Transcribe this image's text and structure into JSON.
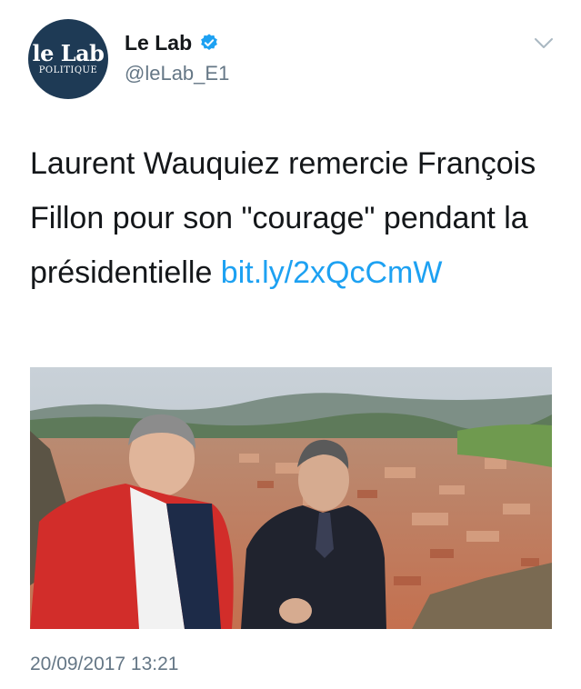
{
  "account": {
    "display_name": "Le Lab",
    "handle": "@leLab_E1",
    "verified": true,
    "avatar": {
      "brand": "le Lab",
      "sub": "POLITIQUE",
      "color": "#1e3a55"
    }
  },
  "tweet": {
    "text_plain": "Laurent Wauquiez remercie François Fillon pour son \"courage\" pendant la présidentielle ",
    "link_text": "bit.ly/2xQcCmW",
    "link_color": "#1da1f2",
    "timestamp": "20/09/2017 13:21"
  },
  "photo": {
    "description_icon": "photo-image",
    "content": "two men outdoors overlooking a town with red rooftops and green hills"
  },
  "icons": {
    "verified": "verified-badge-icon",
    "menu": "chevron-down-icon"
  }
}
